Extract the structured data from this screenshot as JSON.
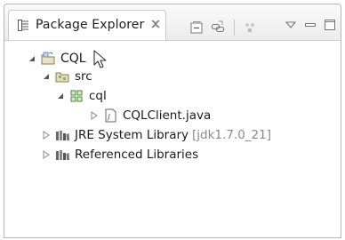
{
  "view": {
    "tab_label": "Package Explorer",
    "tab_icon": "package-explorer-icon",
    "close_icon": "close-icon",
    "toolbar": [
      {
        "name": "collapse-all-icon"
      },
      {
        "name": "link-with-editor-icon"
      },
      {
        "name": "focus-on-active-task-icon"
      },
      {
        "name": "view-menu-icon"
      },
      {
        "name": "minimize-icon"
      },
      {
        "name": "maximize-icon"
      }
    ]
  },
  "tree": {
    "project": {
      "label": "CQL",
      "expanded": true,
      "icon": "java-project-icon"
    },
    "src": {
      "label": "src",
      "expanded": true,
      "icon": "source-folder-icon"
    },
    "package": {
      "label": "cql",
      "expanded": true,
      "icon": "package-icon"
    },
    "file": {
      "label": "CQLClient.java",
      "expanded": false,
      "icon": "java-file-icon"
    },
    "jre": {
      "label": "JRE System Library",
      "decoration": "[jdk1.7.0_21]",
      "expanded": false,
      "icon": "library-icon"
    },
    "referenced": {
      "label": "Referenced Libraries",
      "expanded": false,
      "icon": "library-icon"
    }
  },
  "colors": {
    "frame_border": "#b5b5b5",
    "decoration_text": "#8a8a8a",
    "package_icon": "#4a8a3a"
  }
}
